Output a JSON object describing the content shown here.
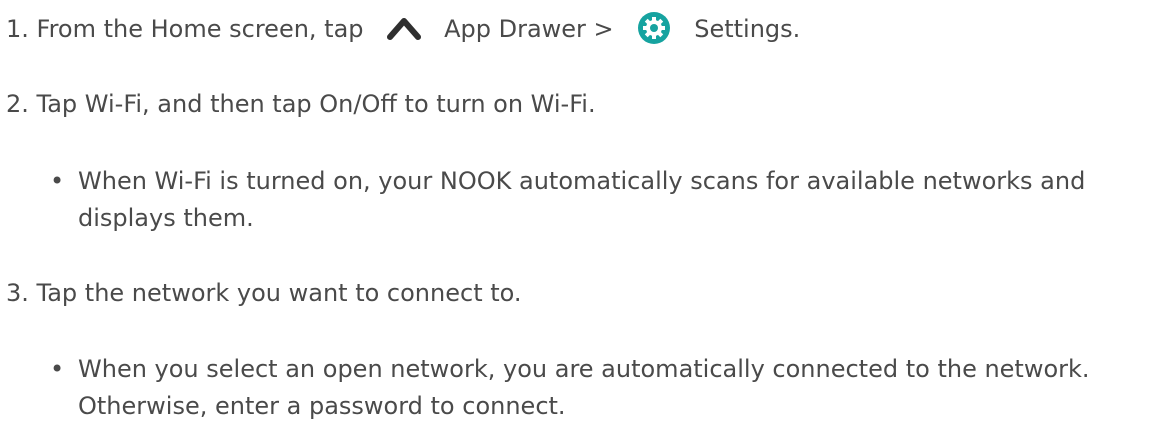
{
  "steps": {
    "step1": {
      "prefix": "1. From the Home screen, tap",
      "app_drawer": "App Drawer >",
      "settings": "Settings."
    },
    "step2": {
      "text": "2. Tap Wi-Fi, and then tap On/Off to turn on Wi-Fi.",
      "bullet": "•",
      "bullet_line1": "When Wi-Fi is turned on, your NOOK automatically scans for available networks and",
      "bullet_line2": "displays them."
    },
    "step3": {
      "text": "3. Tap the network you want to connect to.",
      "bullet": "•",
      "bullet_line1": "When you select an open network, you are automatically connected to the network.",
      "bullet_line2": "Otherwise, enter a password to connect."
    }
  },
  "icons": {
    "app_drawer": "chevron-up-icon",
    "settings": "gear-icon"
  },
  "colors": {
    "text": "#4a4a4a",
    "icon_dark": "#2f2f2f",
    "settings_teal": "#16a3a0"
  }
}
